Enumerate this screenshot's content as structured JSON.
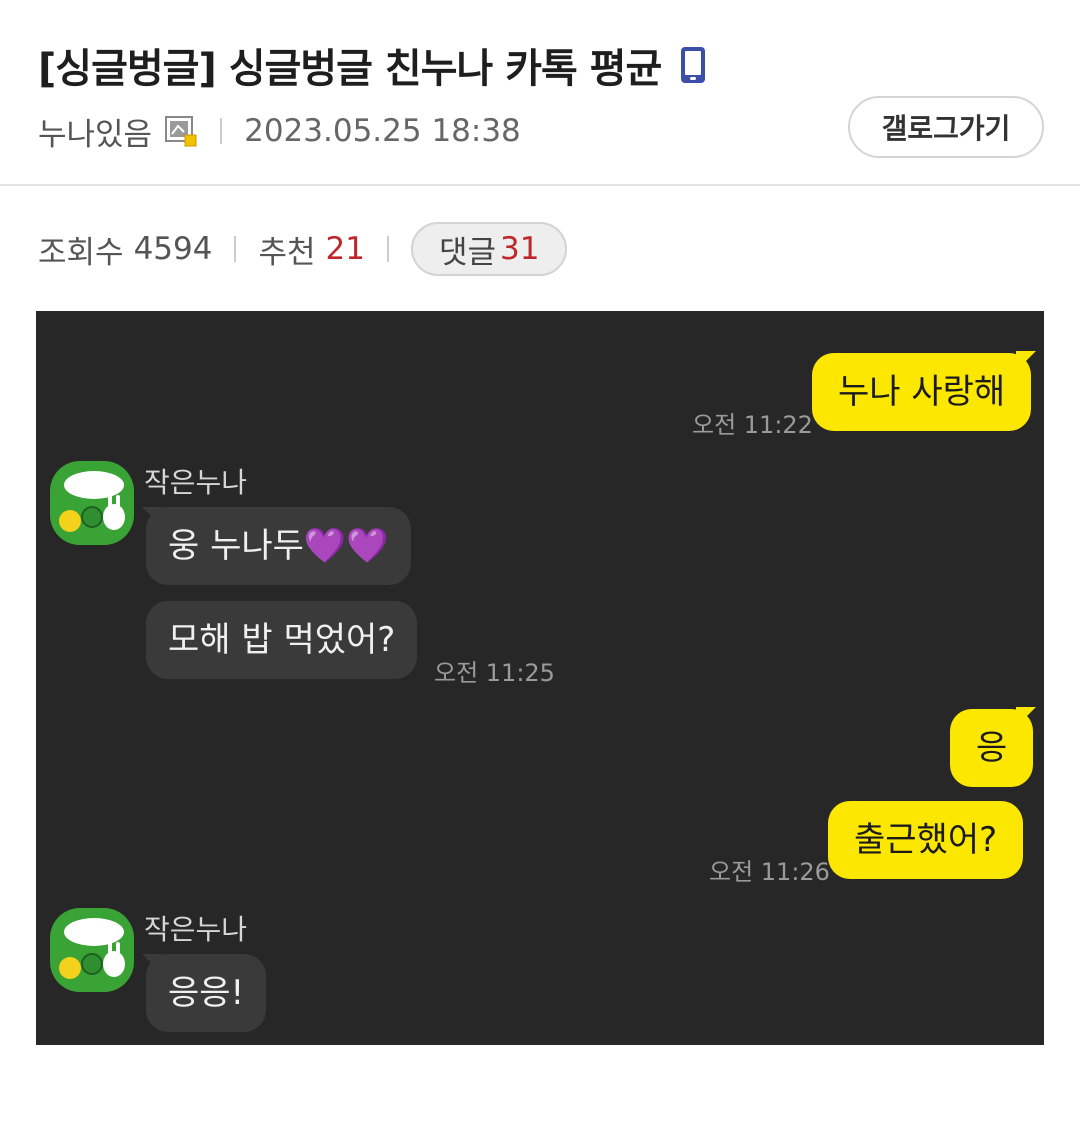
{
  "post": {
    "title": "[싱글벙글] 싱글벙글 친누나 카톡 평균",
    "author": "누나있음",
    "date": "2023.05.25 18:38",
    "gallog_button": "갤로그가기"
  },
  "stats": {
    "views_label": "조회수",
    "views": "4594",
    "recommend_label": "추천",
    "recommend": "21",
    "comments_label": "댓글",
    "comments": "31"
  },
  "chat": {
    "messages": [
      {
        "from": "me",
        "text": "누나 사랑해",
        "time": "오전 11:22"
      },
      {
        "from": "sister",
        "sender": "작은누나",
        "text": "웅 누나두💜💜"
      },
      {
        "from": "sister",
        "text": "모해 밥 먹었어?",
        "time": "오전 11:25"
      },
      {
        "from": "me",
        "text": "응"
      },
      {
        "from": "me",
        "text": "출근했어?",
        "time": "오전 11:26"
      },
      {
        "from": "sister",
        "sender": "작은누나",
        "text": "응응!"
      }
    ]
  },
  "colors": {
    "accent_red": "#c0272d",
    "chat_bg": "#272727",
    "my_bubble": "#fce700",
    "their_bubble": "#3a3a3a",
    "mobile_icon": "#3b4ea8"
  },
  "icons": [
    "mobile-icon",
    "member-icon",
    "avatar"
  ]
}
